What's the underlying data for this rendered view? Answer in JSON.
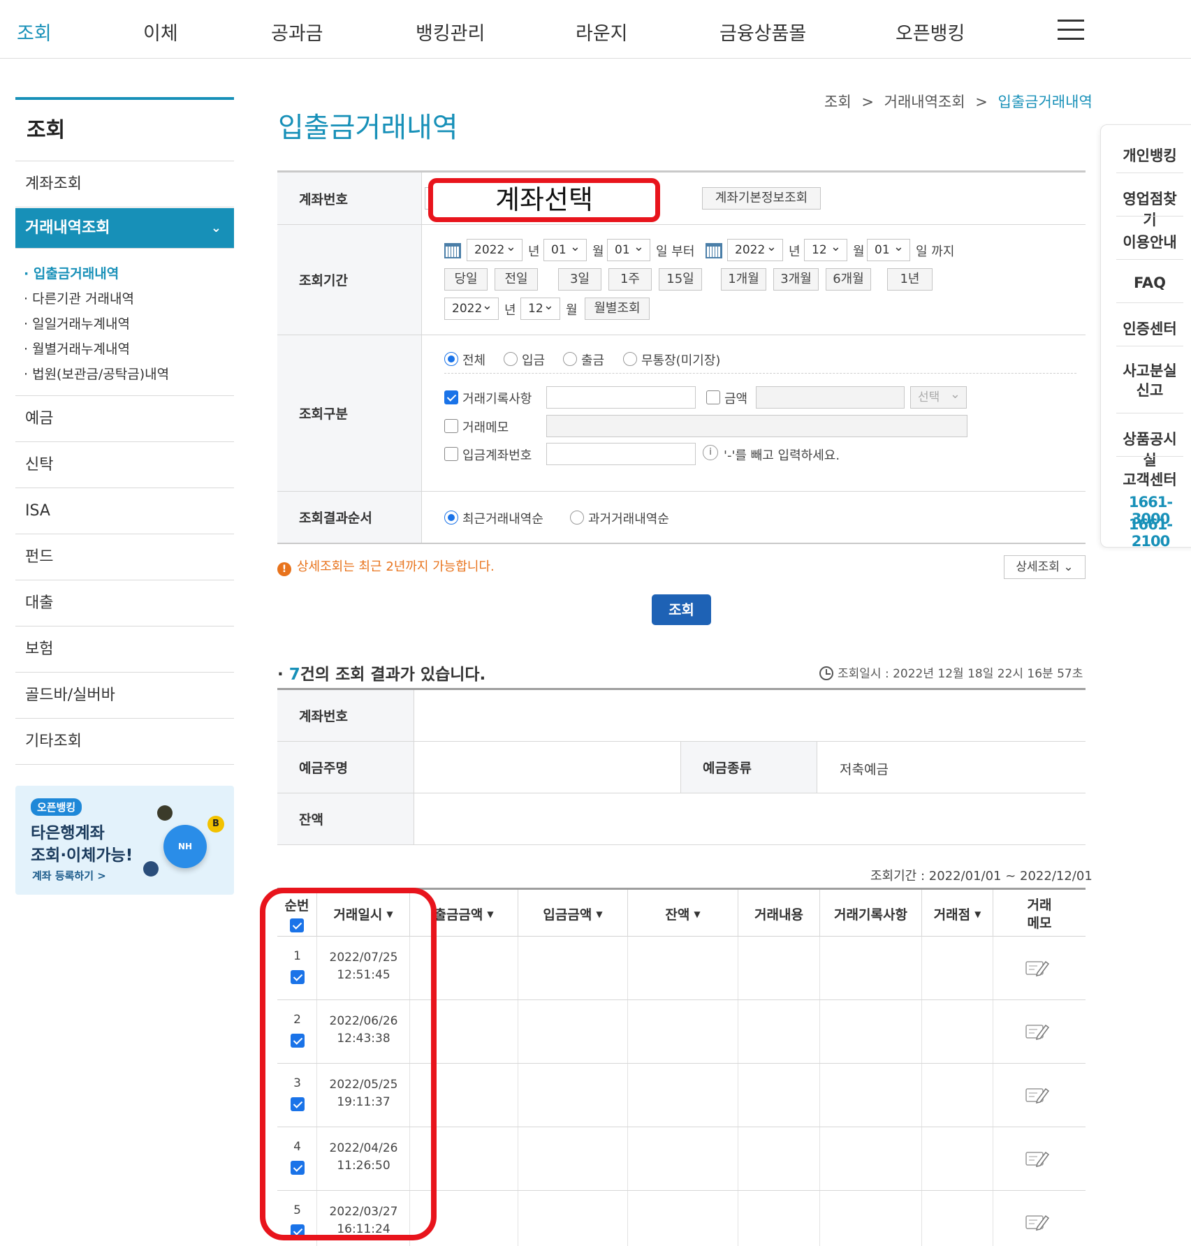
{
  "topnav": [
    "조회",
    "이체",
    "공과금",
    "뱅킹관리",
    "라운지",
    "금융상품몰",
    "오픈뱅킹"
  ],
  "sidebar": {
    "title": "조회",
    "menu_account": "계좌조회",
    "menu_active": "거래내역조회",
    "subs": [
      "입출금거래내역",
      "다른기관 거래내역",
      "일일거래누계내역",
      "월별거래누계내역",
      "법원(보관금/공탁금)내역"
    ],
    "menus": [
      "예금",
      "신탁",
      "ISA",
      "펀드",
      "대출",
      "보험",
      "골드바/실버바",
      "기타조회"
    ],
    "banner": {
      "tag": "오픈뱅킹",
      "line1": "타은행계좌",
      "line2": "조회·이체가능!",
      "link": "계좌 등록하기 >",
      "logo": "NH"
    }
  },
  "quick": {
    "items": [
      "개인뱅킹",
      "영업점찾기",
      "이용안내",
      "FAQ",
      "인증센터",
      "사고분실\n신고",
      "상품공시실",
      "고객센터"
    ],
    "tel1": "1661-3000",
    "tel2": "1661-2100"
  },
  "breadcrumb": {
    "a": "조회",
    "b": "거래내역조회",
    "c": "입출금거래내역",
    "sep": ">"
  },
  "page_title": "입출금거래내역",
  "form": {
    "account_label": "계좌번호",
    "account_select_overlay": "계좌선택",
    "account_info_btn": "계좌기본정보조회",
    "period_label": "조회기간",
    "from_year": "2022",
    "from_month": "01",
    "from_day": "01",
    "to_year": "2022",
    "to_month": "12",
    "to_day": "01",
    "unit_year": "년",
    "unit_month": "월",
    "unit_from": "일 부터",
    "unit_to": "일 까지",
    "quick_buttons": [
      "당일",
      "전일",
      "3일",
      "1주",
      "15일",
      "1개월",
      "3개월",
      "6개월",
      "1년"
    ],
    "monthly_year": "2022",
    "monthly_month": "12",
    "monthly_btn": "월별조회",
    "type_label": "조회구분",
    "radios": [
      "전체",
      "입금",
      "출금",
      "무통장(미기장)"
    ],
    "record_label": "거래기록사항",
    "amount_label": "금액",
    "select_placeholder": "선택",
    "memo_label": "거래메모",
    "deposit_acct_label": "입금계좌번호",
    "deposit_hint": "'-'를 빼고 입력하세요.",
    "order_label": "조회결과순서",
    "order_recent": "최근거래내역순",
    "order_past": "과거거래내역순"
  },
  "notice": "상세조회는 최근 2년까지 가능합니다.",
  "detail_btn": "상세조회 ⌄",
  "search_btn": "조회",
  "result": {
    "count_prefix": "· ",
    "count": "7",
    "count_text": "건의 조회 결과가 있습니다.",
    "time": "조회일시 : 2022년 12월 18일 22시 16분 57초"
  },
  "info": {
    "account_label": "계좌번호",
    "owner_label": "예금주명",
    "type_label": "예금종류",
    "type_value": "저축예금",
    "balance_label": "잔액"
  },
  "period_text": "조회기간 : 2022/01/01 ~ 2022/12/01",
  "grid": {
    "headers": [
      "순번",
      "거래일시",
      "출금금액",
      "입금금액",
      "잔액",
      "거래내용",
      "거래기록사항",
      "거래점",
      "거래\n메모"
    ],
    "rows": [
      {
        "no": "1",
        "date": "2022/07/25",
        "time": "12:51:45"
      },
      {
        "no": "2",
        "date": "2022/06/26",
        "time": "12:43:38"
      },
      {
        "no": "3",
        "date": "2022/05/25",
        "time": "19:11:37"
      },
      {
        "no": "4",
        "date": "2022/04/26",
        "time": "11:26:50"
      },
      {
        "no": "5",
        "date": "2022/03/27",
        "time": "16:11:24"
      }
    ]
  },
  "colors": {
    "accent": "#1790b8",
    "primary_btn": "#1e62b5",
    "highlight": "#e8141c",
    "notice": "#e8731c"
  }
}
